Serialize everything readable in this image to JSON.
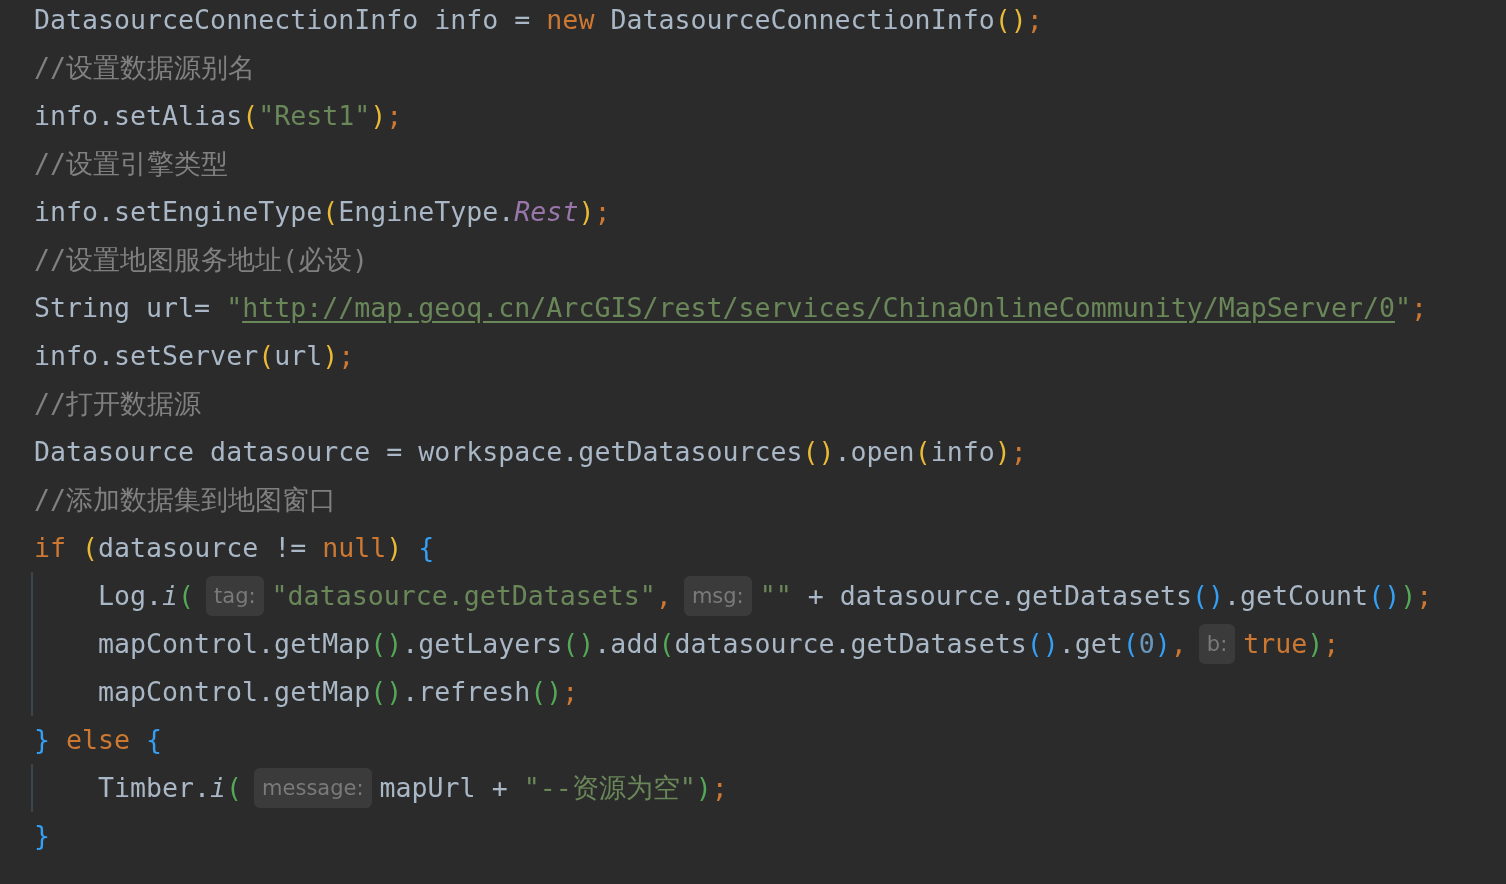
{
  "lines": [
    {
      "tokens": [
        {
          "kind": "plain",
          "text": "DatasourceConnectionInfo info = "
        },
        {
          "kind": "keyword",
          "text": "new"
        },
        {
          "kind": "plain",
          "text": " DatasourceConnectionInfo"
        },
        {
          "kind": "bracket1",
          "text": "()"
        },
        {
          "kind": "punct",
          "text": ";"
        }
      ]
    },
    {
      "tokens": [
        {
          "kind": "comment",
          "text": "//设置数据源别名"
        }
      ]
    },
    {
      "tokens": [
        {
          "kind": "plain",
          "text": "info.setAlias"
        },
        {
          "kind": "bracket1",
          "text": "("
        },
        {
          "kind": "string",
          "text": "\"Rest1\""
        },
        {
          "kind": "bracket1",
          "text": ")"
        },
        {
          "kind": "punct",
          "text": ";"
        }
      ]
    },
    {
      "tokens": [
        {
          "kind": "comment",
          "text": "//设置引擎类型"
        }
      ]
    },
    {
      "tokens": [
        {
          "kind": "plain",
          "text": "info.setEngineType"
        },
        {
          "kind": "bracket1",
          "text": "("
        },
        {
          "kind": "plain",
          "text": "EngineType."
        },
        {
          "kind": "constant",
          "text": "Rest"
        },
        {
          "kind": "bracket1",
          "text": ")"
        },
        {
          "kind": "punct",
          "text": ";"
        }
      ]
    },
    {
      "tokens": [
        {
          "kind": "comment",
          "text": "//设置地图服务地址(必设)"
        }
      ]
    },
    {
      "tokens": [
        {
          "kind": "plain",
          "text": "String url= "
        },
        {
          "kind": "string",
          "text": "\""
        },
        {
          "kind": "url",
          "text": "http://map.geoq.cn/ArcGIS/rest/services/ChinaOnlineCommunity/MapServer/0"
        },
        {
          "kind": "string",
          "text": "\""
        },
        {
          "kind": "punct",
          "text": ";"
        }
      ]
    },
    {
      "tokens": [
        {
          "kind": "plain",
          "text": "info.setServer"
        },
        {
          "kind": "bracket1",
          "text": "("
        },
        {
          "kind": "plain",
          "text": "url"
        },
        {
          "kind": "bracket1",
          "text": ")"
        },
        {
          "kind": "punct",
          "text": ";"
        }
      ]
    },
    {
      "tokens": [
        {
          "kind": "comment",
          "text": "//打开数据源"
        }
      ]
    },
    {
      "tokens": [
        {
          "kind": "plain",
          "text": "Datasource datasource = workspace.getDatasources"
        },
        {
          "kind": "bracket1",
          "text": "()"
        },
        {
          "kind": "plain",
          "text": ".open"
        },
        {
          "kind": "bracket1",
          "text": "("
        },
        {
          "kind": "plain",
          "text": "info"
        },
        {
          "kind": "bracket1",
          "text": ")"
        },
        {
          "kind": "punct",
          "text": ";"
        }
      ]
    },
    {
      "tokens": [
        {
          "kind": "comment",
          "text": "//添加数据集到地图窗口"
        }
      ]
    },
    {
      "tokens": [
        {
          "kind": "keyword",
          "text": "if "
        },
        {
          "kind": "bracket1",
          "text": "("
        },
        {
          "kind": "plain",
          "text": "datasource != "
        },
        {
          "kind": "keyword",
          "text": "null"
        },
        {
          "kind": "bracket1",
          "text": ")"
        },
        {
          "kind": "bracket3",
          "text": " {"
        }
      ],
      "children": [
        {
          "tokens": [
            {
              "kind": "plain",
              "text": "Log."
            },
            {
              "kind": "method",
              "text": "i"
            },
            {
              "kind": "bracket2",
              "text": "("
            },
            {
              "kind": "hint",
              "text": "tag:"
            },
            {
              "kind": "string",
              "text": "\"datasource.getDatasets\""
            },
            {
              "kind": "punct",
              "text": ","
            },
            {
              "kind": "hint",
              "text": "msg:"
            },
            {
              "kind": "string",
              "text": "\"\""
            },
            {
              "kind": "plain",
              "text": " + datasource.getDatasets"
            },
            {
              "kind": "bracket3",
              "text": "()"
            },
            {
              "kind": "plain",
              "text": ".getCount"
            },
            {
              "kind": "bracket3",
              "text": "()"
            },
            {
              "kind": "bracket2",
              "text": ")"
            },
            {
              "kind": "punct",
              "text": ";"
            }
          ]
        },
        {
          "tokens": [
            {
              "kind": "plain",
              "text": "mapControl.getMap"
            },
            {
              "kind": "bracket2",
              "text": "()"
            },
            {
              "kind": "plain",
              "text": ".getLayers"
            },
            {
              "kind": "bracket2",
              "text": "()"
            },
            {
              "kind": "plain",
              "text": ".add"
            },
            {
              "kind": "bracket2",
              "text": "("
            },
            {
              "kind": "plain",
              "text": "datasource.getDatasets"
            },
            {
              "kind": "bracket3",
              "text": "()"
            },
            {
              "kind": "plain",
              "text": ".get"
            },
            {
              "kind": "bracket3",
              "text": "("
            },
            {
              "kind": "number",
              "text": "0"
            },
            {
              "kind": "bracket3",
              "text": ")"
            },
            {
              "kind": "punct",
              "text": ","
            },
            {
              "kind": "hint",
              "text": "b:"
            },
            {
              "kind": "keyword",
              "text": "true"
            },
            {
              "kind": "bracket2",
              "text": ")"
            },
            {
              "kind": "punct",
              "text": ";"
            }
          ]
        },
        {
          "tokens": [
            {
              "kind": "plain",
              "text": "mapControl.getMap"
            },
            {
              "kind": "bracket2",
              "text": "()"
            },
            {
              "kind": "plain",
              "text": ".refresh"
            },
            {
              "kind": "bracket2",
              "text": "()"
            },
            {
              "kind": "punct",
              "text": ";"
            }
          ]
        }
      ]
    },
    {
      "tokens": [
        {
          "kind": "bracket3",
          "text": "} "
        },
        {
          "kind": "keyword",
          "text": "else "
        },
        {
          "kind": "bracket3",
          "text": "{"
        }
      ],
      "children": [
        {
          "tokens": [
            {
              "kind": "plain",
              "text": "Timber."
            },
            {
              "kind": "method",
              "text": "i"
            },
            {
              "kind": "bracket2",
              "text": "("
            },
            {
              "kind": "hint",
              "text": "message:"
            },
            {
              "kind": "plain",
              "text": "mapUrl + "
            },
            {
              "kind": "string",
              "text": "\"--资源为空\""
            },
            {
              "kind": "bracket2",
              "text": ")"
            },
            {
              "kind": "punct",
              "text": ";"
            }
          ]
        }
      ]
    },
    {
      "tokens": [
        {
          "kind": "bracket3",
          "text": "}"
        }
      ]
    }
  ]
}
